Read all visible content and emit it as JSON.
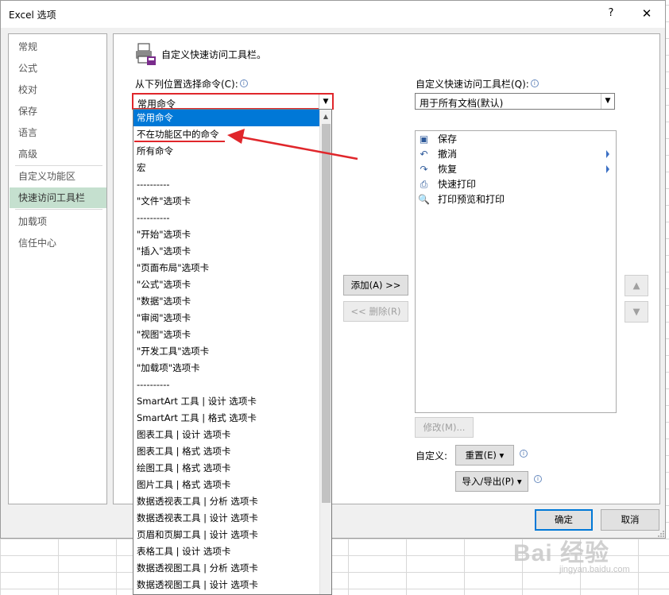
{
  "window": {
    "title": "Excel 选项",
    "help_glyph": "?",
    "close_glyph": "✕"
  },
  "nav": {
    "items": [
      {
        "label": "常规",
        "active": false
      },
      {
        "label": "公式",
        "active": false
      },
      {
        "label": "校对",
        "active": false
      },
      {
        "label": "保存",
        "active": false
      },
      {
        "label": "语言",
        "active": false
      },
      {
        "label": "高级",
        "active": false
      },
      {
        "label": "自定义功能区",
        "active": false
      },
      {
        "label": "快速访问工具栏",
        "active": true
      },
      {
        "label": "加载项",
        "active": false
      },
      {
        "label": "信任中心",
        "active": false
      }
    ]
  },
  "header": {
    "text": "自定义快速访问工具栏。",
    "icon": "toolbar-customize-icon"
  },
  "commands": {
    "label": "从下列位置选择命令(C):",
    "selected": "常用命令",
    "options": [
      "常用命令",
      "不在功能区中的命令",
      "所有命令",
      "宏",
      "----------",
      "\"文件\"选项卡",
      "----------",
      "\"开始\"选项卡",
      "\"插入\"选项卡",
      "\"页面布局\"选项卡",
      "\"公式\"选项卡",
      "\"数据\"选项卡",
      "\"审阅\"选项卡",
      "\"视图\"选项卡",
      "\"开发工具\"选项卡",
      "\"加载项\"选项卡",
      "----------",
      "SmartArt 工具 | 设计 选项卡",
      "SmartArt 工具 | 格式 选项卡",
      "图表工具 | 设计 选项卡",
      "图表工具 | 格式 选项卡",
      "绘图工具 | 格式 选项卡",
      "图片工具 | 格式 选项卡",
      "数据透视表工具 | 分析 选项卡",
      "数据透视表工具 | 设计 选项卡",
      "页眉和页脚工具 | 设计 选项卡",
      "表格工具 | 设计 选项卡",
      "数据透视图工具 | 分析 选项卡",
      "数据透视图工具 | 设计 选项卡"
    ]
  },
  "toolbar_scope": {
    "label": "自定义快速访问工具栏(Q):",
    "selected": "用于所有文档(默认)"
  },
  "qa_items": [
    {
      "label": "保存",
      "icon": "save-icon",
      "glyph": "▣",
      "expandable": false
    },
    {
      "label": "撤消",
      "icon": "undo-icon",
      "glyph": "↶",
      "expandable": true
    },
    {
      "label": "恢复",
      "icon": "redo-icon",
      "glyph": "↷",
      "expandable": true
    },
    {
      "label": "快速打印",
      "icon": "quick-print-icon",
      "glyph": "⎙",
      "expandable": false
    },
    {
      "label": "打印预览和打印",
      "icon": "print-preview-icon",
      "glyph": "🔍",
      "expandable": false
    }
  ],
  "buttons": {
    "add": "添加(A) >>",
    "remove": "<< 删除(R)",
    "move_up": "▲",
    "move_down": "▼",
    "modify": "修改(M)...",
    "custom_label": "自定义:",
    "reset": "重置(E) ▾",
    "import_export": "导入/导出(P) ▾",
    "ok": "确定",
    "cancel": "取消"
  },
  "watermark": {
    "logo": "Bai 经验",
    "url": "jingyan.baidu.com"
  },
  "colors": {
    "accent": "#0078d7",
    "nav_active": "#c5e0cf",
    "annotation": "#e0262b"
  }
}
